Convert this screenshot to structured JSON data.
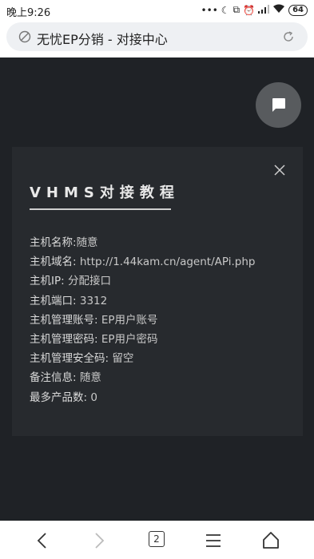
{
  "status_bar": {
    "time": "晚上9:26",
    "icons": [
      "dots-icon",
      "moon-icon",
      "screen-icon",
      "alarm-icon",
      "signal-icon",
      "wifi-icon"
    ],
    "battery": "64"
  },
  "browser": {
    "page_title": "无忧EP分销 - 对接中心",
    "tab_count": "2"
  },
  "modal": {
    "heading": "VHMS对接教程",
    "fields": [
      {
        "label": "主机名称:",
        "value": "随意"
      },
      {
        "label": "主机域名:",
        "value": " http://1.44kam.cn/agent/APi.php"
      },
      {
        "label": "主机IP:",
        "value": " 分配接口"
      },
      {
        "label": "主机端口:",
        "value": " 3312"
      },
      {
        "label": "主机管理账号:",
        "value": " EP用户账号"
      },
      {
        "label": "主机管理密码:",
        "value": " EP用户密码"
      },
      {
        "label": "主机管理安全码:",
        "value": " 留空"
      },
      {
        "label": "备注信息:",
        "value": " 随意"
      },
      {
        "label": "最多产品数:",
        "value": " 0"
      }
    ]
  },
  "colors": {
    "page_bg": "#1f2226",
    "modal_bg": "#272a2e",
    "fab_bg": "#585b5e"
  }
}
